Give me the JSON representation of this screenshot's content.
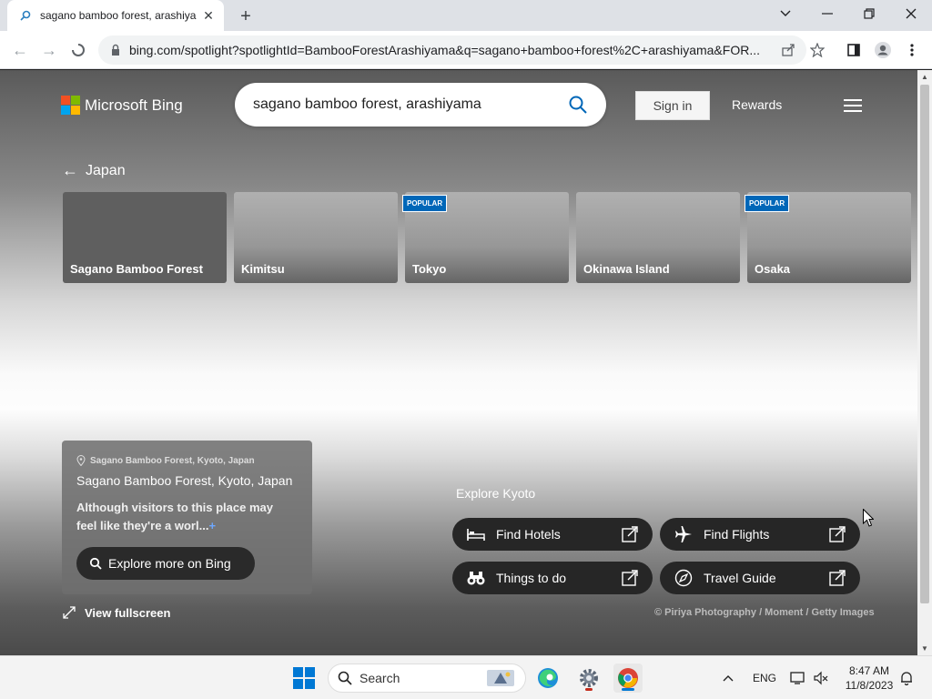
{
  "browser": {
    "tab_title": "sagano bamboo forest, arashiya",
    "favicon": "bing-search-icon",
    "new_tab": "+",
    "url": "bing.com/spotlight?spotlightId=BambooForestArashiyama&q=sagano+bamboo+forest%2C+arashiyama&FOR..."
  },
  "header": {
    "logo_text": "Microsoft Bing",
    "search_query": "sagano bamboo forest, arashiyama",
    "sign_in": "Sign in",
    "rewards": "Rewards"
  },
  "breadcrumb": {
    "label": "Japan"
  },
  "destinations": [
    {
      "label": "Sagano Bamboo Forest",
      "badge": "",
      "active": true
    },
    {
      "label": "Kimitsu",
      "badge": "",
      "active": false
    },
    {
      "label": "Tokyo",
      "badge": "POPULAR",
      "active": false
    },
    {
      "label": "Okinawa Island",
      "badge": "",
      "active": false
    },
    {
      "label": "Osaka",
      "badge": "POPULAR",
      "active": false
    }
  ],
  "info": {
    "location": "Sagano Bamboo Forest, Kyoto, Japan",
    "title": "Sagano Bamboo Forest, Kyoto, Japan",
    "description": "Although visitors to this place may feel like they're a worl...",
    "more_glyph": "+",
    "explore_button": "Explore more on Bing"
  },
  "view_fullscreen": "View fullscreen",
  "explore": {
    "heading": "Explore Kyoto",
    "actions": [
      {
        "label": "Find Hotels",
        "icon": "bed-icon"
      },
      {
        "label": "Find Flights",
        "icon": "airplane-icon"
      },
      {
        "label": "Things to do",
        "icon": "binoculars-icon"
      },
      {
        "label": "Travel Guide",
        "icon": "compass-icon"
      }
    ]
  },
  "credit": "© Piriya Photography / Moment / Getty Images",
  "taskbar": {
    "search_label": "Search",
    "language": "ENG",
    "time": "8:47 AM",
    "date": "11/8/2023"
  },
  "colors": {
    "bing_blue": "#0067b8",
    "windows_blue": "#0078d4",
    "ms_red": "#f25022",
    "ms_green": "#7fba00",
    "ms_blue": "#00a4ef",
    "ms_yellow": "#ffb900"
  }
}
